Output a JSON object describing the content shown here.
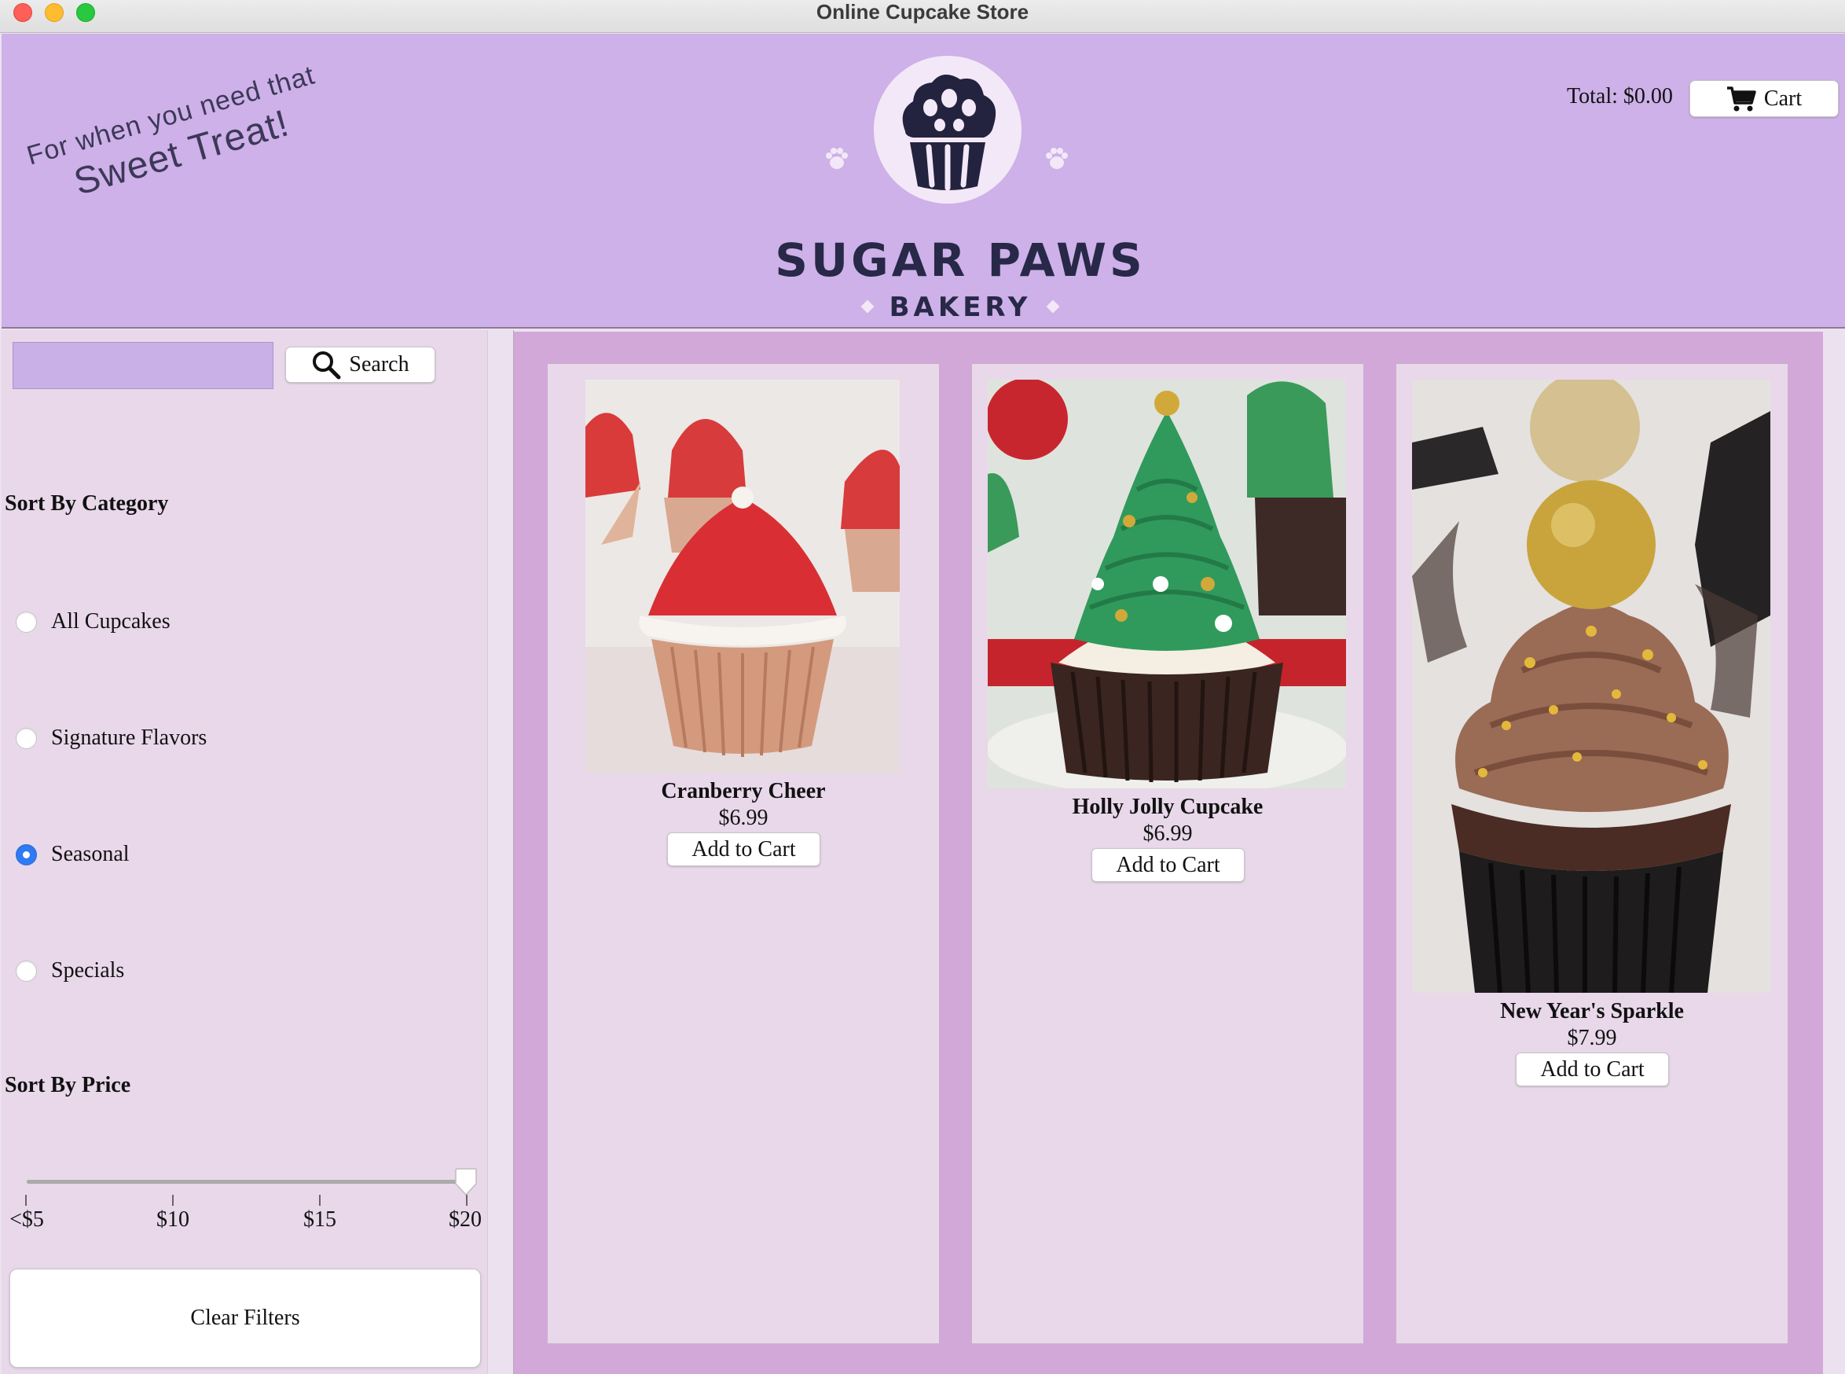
{
  "window": {
    "title": "Online Cupcake Store"
  },
  "header": {
    "tagline_line1": "For when you need that",
    "tagline_line2": "Sweet Treat!",
    "brand_name": "SUGAR PAWS",
    "brand_sub": "BAKERY",
    "total_label": "Total: $0.00",
    "cart_label": "Cart"
  },
  "sidebar": {
    "search": {
      "value": "",
      "placeholder": "",
      "button_label": "Search"
    },
    "category_title": "Sort By Category",
    "categories": [
      {
        "label": "All Cupcakes",
        "selected": false
      },
      {
        "label": "Signature Flavors",
        "selected": false
      },
      {
        "label": "Seasonal",
        "selected": true
      },
      {
        "label": "Specials",
        "selected": false
      }
    ],
    "price_title": "Sort By Price",
    "price_slider": {
      "ticks": [
        "<$5",
        "$10",
        "$15",
        "$20"
      ],
      "selected": "$20"
    },
    "clear_label": "Clear Filters"
  },
  "products": [
    {
      "name": "Cranberry Cheer",
      "price": "$6.99",
      "button_label": "Add to Cart"
    },
    {
      "name": "Holly Jolly Cupcake",
      "price": "$6.99",
      "button_label": "Add to Cart"
    },
    {
      "name": "New Year's Sparkle",
      "price": "$7.99",
      "button_label": "Add to Cart"
    }
  ],
  "colors": {
    "header_bg": "#cdb1e8",
    "sidebar_bg": "#e8d8ea",
    "main_bg": "#d2a8d8",
    "radio_selected": "#2f7bf5",
    "brand_text": "#282848"
  }
}
